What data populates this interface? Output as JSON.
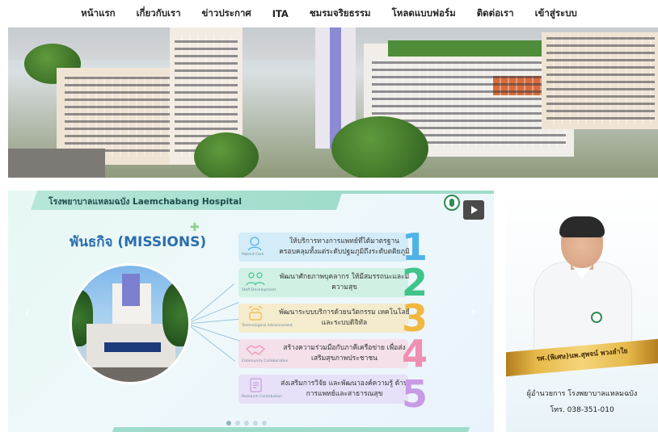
{
  "nav": {
    "items": [
      "หน้าแรก",
      "เกี่ยวกับเรา",
      "ข่าวประกาศ",
      "ITA",
      "ชมรมจริยธรรม",
      "โหลดแบบฟอร์ม",
      "ติดต่อเรา",
      "เข้าสู่ระบบ"
    ]
  },
  "slide": {
    "title": "โรงพยาบาลแหลมฉบัง Laemchabang Hospital",
    "heading": "พันธกิจ (MISSIONS)",
    "missions": [
      {
        "number": "1",
        "caption": "Patient Care",
        "text": "ให้บริการทางการแพทย์ที่ได้มาตรฐาน ครอบคลุมทั้งแต่ระดับปฐมภูมิถึงระดับตติยภูมิ",
        "color": "#4fb3e8",
        "icon": "patient-care-icon"
      },
      {
        "number": "2",
        "caption": "Staff Development",
        "text": "พัฒนาศักยภาพบุคลากร ให้มีสมรรถนะและมีความสุข",
        "color": "#3fc48a",
        "icon": "staff-development-icon"
      },
      {
        "number": "3",
        "caption": "Technological Advancement",
        "text": "พัฒนาระบบบริการด้วยนวัตกรรม เทคโนโลยี และระบบดิจิทัล",
        "color": "#f0b840",
        "icon": "technology-icon"
      },
      {
        "number": "4",
        "caption": "Community Collaboration",
        "text": "สร้างความร่วมมือกับภาคีเครือข่าย เพื่อส่งเสริมสุขภาพประชาชน",
        "color": "#ef8fb2",
        "icon": "handshake-icon"
      },
      {
        "number": "5",
        "caption": "Research Contribution",
        "text": "ส่งเสริมการวิจัย และพัฒนาองค์ความรู้ ด้านการแพทย์และสาธารณสุข",
        "color": "#c89ae6",
        "icon": "research-icon"
      }
    ]
  },
  "director": {
    "name": "รศ.(พิเศษ)นพ.สุพจน์ พวงลำใย",
    "title": "ผู้อำนวยการ โรงพยาบาลแหลมฉบัง",
    "phone": "โทร. 038-351-010"
  }
}
